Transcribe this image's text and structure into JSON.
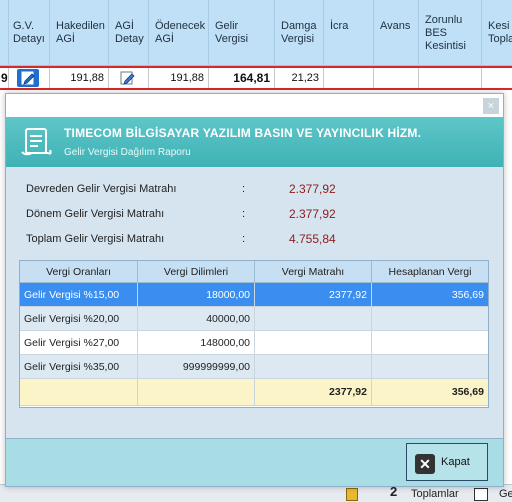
{
  "grid": {
    "headers": [
      "G.V. Detayı",
      "Hakedilen AGİ",
      "AGİ Detay",
      "Ödenecek AGİ",
      "Gelir Vergisi",
      "Damga Vergisi",
      "İcra",
      "Avans",
      "Zorunlu BES Kesintisi",
      "Kesi Topla"
    ],
    "row": {
      "lead_digit": "9",
      "hakedilen_agi": "191,88",
      "odenecek_agi": "191,88",
      "gelir_vergisi": "164,81",
      "damga_vergisi": "21,23"
    }
  },
  "bottom_bar": {
    "number": "2",
    "label": "Toplamlar",
    "trailing": "Ge"
  },
  "dialog": {
    "close_symbol": "×",
    "company": "TIMECOM BİLGİSAYAR YAZILIM BASIN VE YAYINCILIK HİZM.",
    "subtitle": "Gelir Vergisi Dağılım Raporu",
    "summary": [
      {
        "label": "Devreden Gelir Vergisi Matrahı",
        "colon": ":",
        "value": "2.377,92"
      },
      {
        "label": "Dönem Gelir Vergisi Matrahı",
        "colon": ":",
        "value": "2.377,92"
      },
      {
        "label": "Toplam Gelir Vergisi Matrahı",
        "colon": ":",
        "value": "4.755,84"
      }
    ],
    "table": {
      "columns": [
        "Vergi Oranları",
        "Vergi Dilimleri",
        "Vergi Matrahı",
        "Hesaplanan Vergi"
      ],
      "rows": [
        [
          "Gelir Vergisi %15,00",
          "18000,00",
          "2377,92",
          "356,69"
        ],
        [
          "Gelir Vergisi %20,00",
          "40000,00",
          "",
          ""
        ],
        [
          "Gelir Vergisi %27,00",
          "148000,00",
          "",
          ""
        ],
        [
          "Gelir Vergisi %35,00",
          "999999999,00",
          "",
          ""
        ]
      ],
      "totals": [
        "",
        "",
        "2377,92",
        "356,69"
      ]
    },
    "close_button": "Kapat"
  },
  "colors": {
    "banner": "#3fb2b6",
    "selected_row": "#3a8ef0",
    "value_text": "#8b1d1d",
    "totals_row": "#fbf4c8"
  }
}
